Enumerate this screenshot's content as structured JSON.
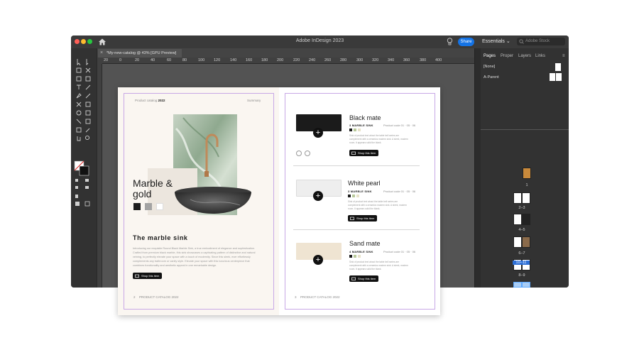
{
  "app": {
    "title": "Adobe InDesign 2023",
    "share_label": "Share",
    "workspace_label": "Essentials",
    "stock_search_placeholder": "Adobe Stock",
    "document_tab": "*My-new-catalog @ 43% [GPU Preview]",
    "close_glyph": "×"
  },
  "ruler": {
    "ticks": [
      "20",
      "0",
      "20",
      "40",
      "60",
      "80",
      "100",
      "120",
      "140",
      "160",
      "180",
      "200",
      "220",
      "240",
      "260",
      "280",
      "300",
      "320",
      "340",
      "360",
      "380",
      "400"
    ]
  },
  "panel": {
    "tabs": [
      "Pages",
      "Proper",
      "Layers",
      "Links"
    ],
    "masters": [
      "[None]",
      "A-Parent"
    ],
    "spreads": [
      "1",
      "2–3",
      "4–5",
      "6–7",
      "8–9",
      "10–11"
    ]
  },
  "left_page": {
    "header_left": "Product catalog",
    "header_year": "2022",
    "header_right": "Summary",
    "headline_line1": "Marble &",
    "headline_line2": "gold",
    "section_title": "The marble sink",
    "body": "Introducing our exquisite Round Black Marble Sink, a true embodiment of elegance and sophistication. Crafted from premium black marble, this sink showcases a captivating pattern of distinctive and natural veining, to perfectly elevate your space with a touch of modernity. Since this sleek, ever effortlessly complements any bathroom or vanity style. Elevate your space with this luxurious centerpiece that combines functionality and aesthetic appeal in one remarkable design.",
    "shop_label": "Shop this item",
    "footer_num": "2",
    "footer_text": "PRODUCT CATALOG 2022",
    "swatches": [
      "#1d1d1d",
      "#a3a3a3",
      "#ffffff"
    ]
  },
  "right_page": {
    "footer_num": "3",
    "footer_text": "PRODUCT CATALOG 2022",
    "products": [
      {
        "title": "Black mate",
        "sub": "3  MARBLE SINK",
        "code": "Product code   01 · 05 · 06",
        "desc": "Sink of product text about the table bell series are complement with a ceramics modern sink. A sleek, modern room. It appears solid the blank.",
        "shop": "Shop this item",
        "image_color": "#1b1b1b"
      },
      {
        "title": "White pearl",
        "sub": "3  MARBLE SINK",
        "code": "Product code   01 · 05 · 06",
        "desc": "Sink of product text about the table bell series are complement with a ceramics modern sink. A sleek, modern room. It appears solid the blank.",
        "shop": "Shop this item",
        "image_color": "#eeeeee"
      },
      {
        "title": "Sand mate",
        "sub": "4  MARBLE SINK",
        "code": "Product code   01 · 05 · 06",
        "desc": "Sink of product text about the table bell series are complement with a ceramics modern sink. A sleek, modern room. It appears solid the blank.",
        "shop": "Shop this item",
        "image_color": "#efe4d2"
      }
    ]
  }
}
